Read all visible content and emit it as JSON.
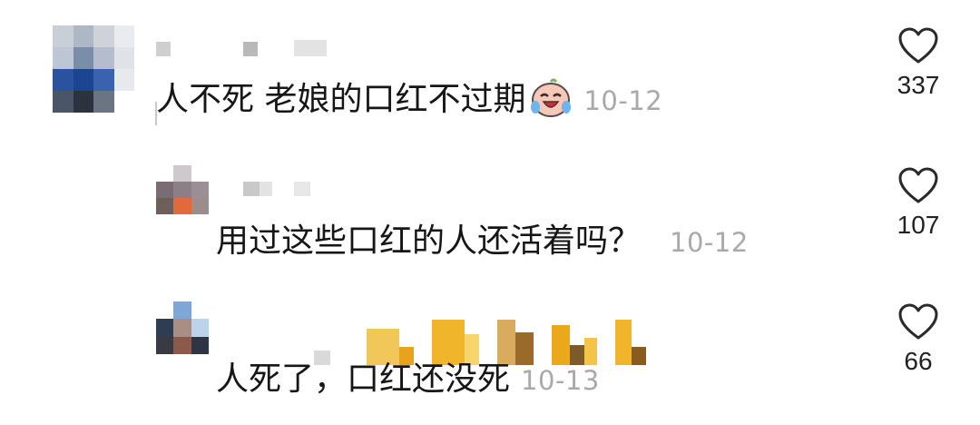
{
  "comments": [
    {
      "text": "人不死 老娘的口红不过期",
      "emoji": "laughing-crying-face-emoji",
      "time": "10-12",
      "likes": "337"
    },
    {
      "text": "用过这些口红的人还活着吗？",
      "time": "10-12",
      "likes": "107"
    },
    {
      "text": "人死了，口红还没死",
      "time": "10-13",
      "likes": "66"
    }
  ],
  "icons": {
    "like": "heart-outline-icon"
  },
  "colors": {
    "text": "#161616",
    "time": "#a9a9a9",
    "heart": "#2a2a2a"
  }
}
